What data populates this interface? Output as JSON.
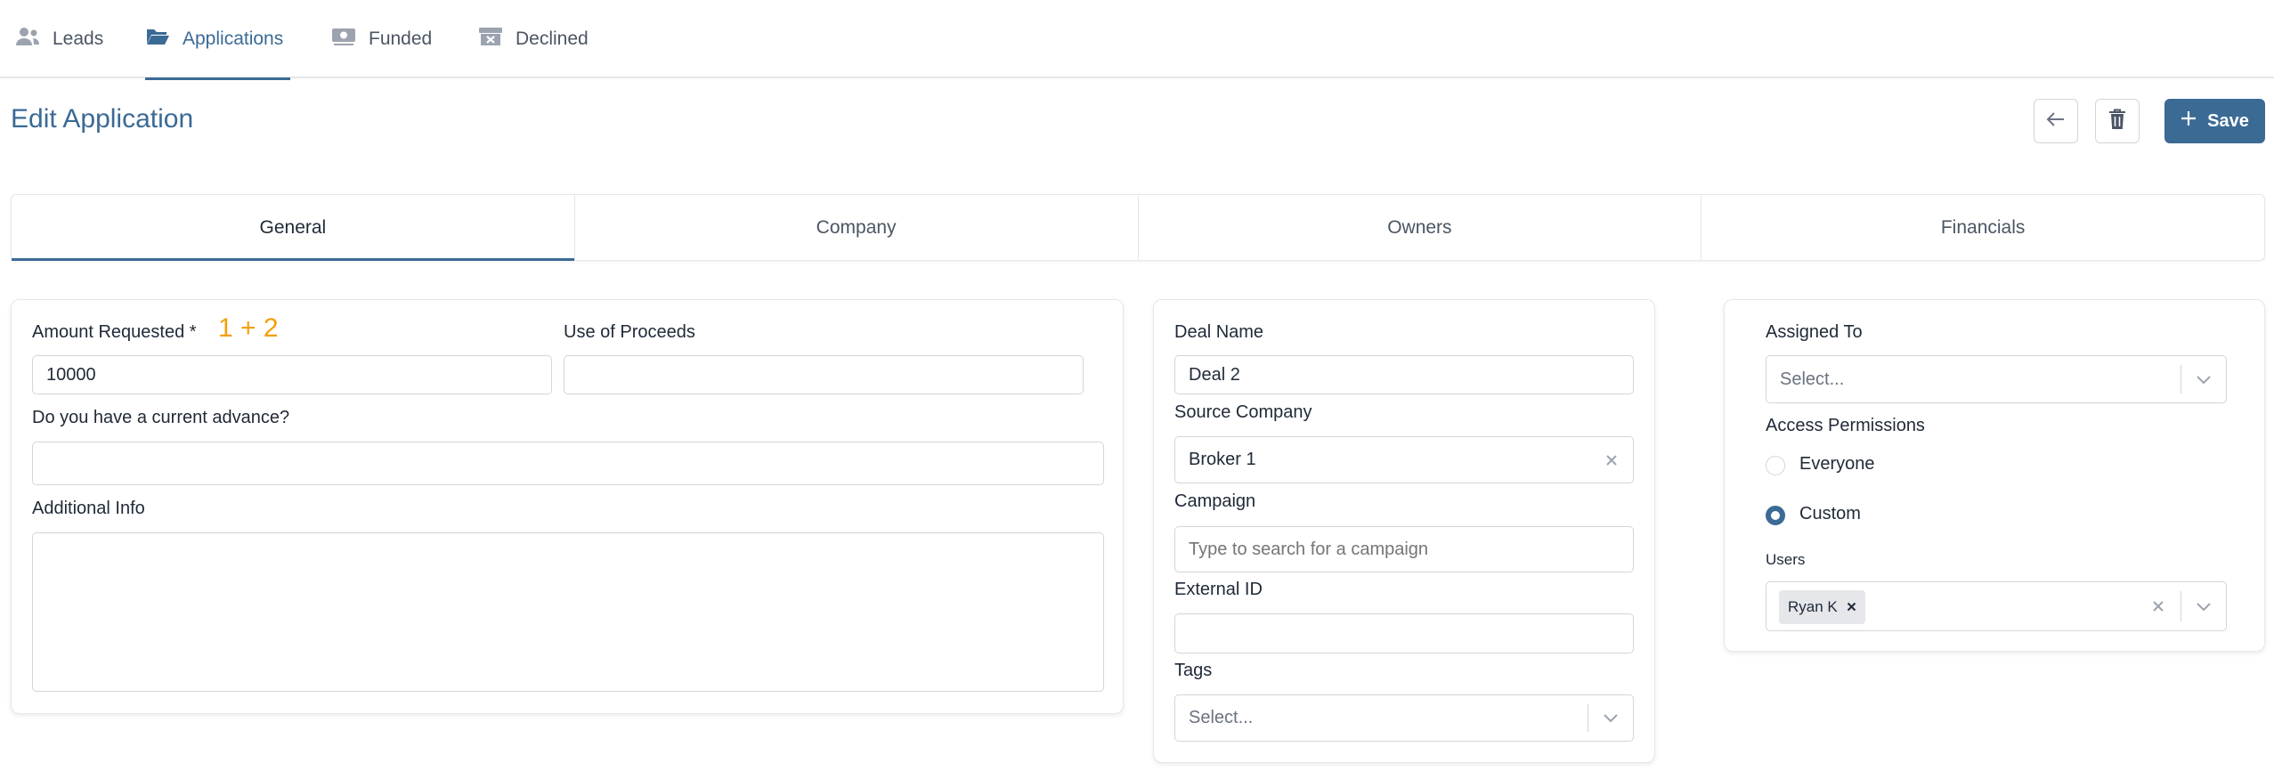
{
  "nav": {
    "tabs": [
      {
        "label": "Leads",
        "icon": "users-icon"
      },
      {
        "label": "Applications",
        "icon": "folder-open-icon"
      },
      {
        "label": "Funded",
        "icon": "money-bill-icon"
      },
      {
        "label": "Declined",
        "icon": "archive-x-icon"
      }
    ],
    "active": "Applications"
  },
  "header": {
    "title": "Edit Application",
    "save_label": "Save"
  },
  "section_tabs": [
    "General",
    "Company",
    "Owners",
    "Financials"
  ],
  "general": {
    "amount_label": "Amount Requested *",
    "amount_annotation": "1 + 2",
    "amount_value": "10000",
    "proceeds_label": "Use of Proceeds",
    "proceeds_value": "",
    "advance_label": "Do you have a current advance?",
    "advance_value": "",
    "info_label": "Additional Info",
    "info_value": ""
  },
  "deal": {
    "name_label": "Deal Name",
    "name_value": "Deal 2",
    "source_label": "Source Company",
    "source_value": "Broker 1",
    "campaign_label": "Campaign",
    "campaign_placeholder": "Type to search for a campaign",
    "external_label": "External ID",
    "external_value": "",
    "tags_label": "Tags",
    "tags_placeholder": "Select..."
  },
  "assign": {
    "assigned_label": "Assigned To",
    "assigned_placeholder": "Select...",
    "access_label": "Access Permissions",
    "option_everyone": "Everyone",
    "option_custom": "Custom",
    "selected_option": "Custom",
    "users_label": "Users",
    "users": [
      "Ryan K"
    ]
  },
  "colors": {
    "accent": "#3b6a95",
    "annotation": "#f59e0b",
    "border": "#d1d5db"
  }
}
